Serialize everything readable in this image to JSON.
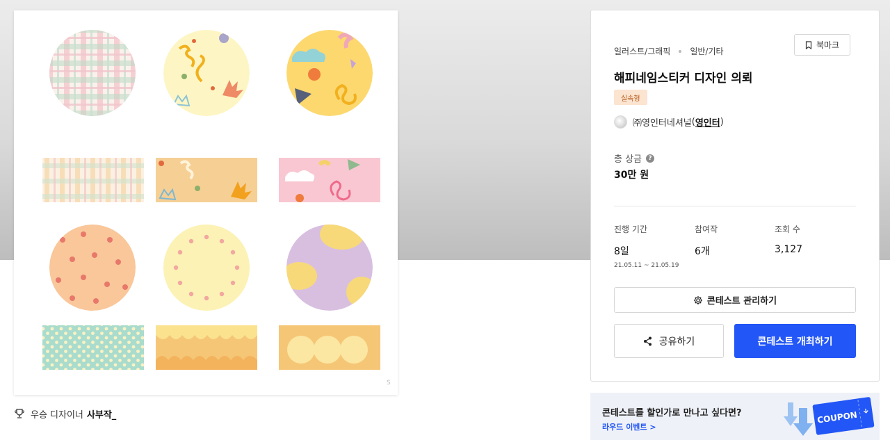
{
  "winner": {
    "label": "우승 디자이너",
    "name": "사부작_"
  },
  "contest": {
    "category": "일러스트/그래픽",
    "subcategory": "일반/기타",
    "title": "해피네임스티커 디자인 의뢰",
    "type_badge": "실속형",
    "host_name": "㈜영인터네셔널",
    "host_handle": "영인터",
    "prize_label": "총 상금",
    "prize_value": "30만 원",
    "stats": {
      "duration_label": "진행 기간",
      "duration_value": "8일",
      "duration_start": "21.05.11",
      "duration_sep": "~",
      "duration_end": "21.05.19",
      "entries_label": "참여작",
      "entries_value": "6개",
      "views_label": "조회 수",
      "views_value": "3,127"
    }
  },
  "buttons": {
    "bookmark": "북마크",
    "manage": "콘테스트 관리하기",
    "share": "공유하기",
    "open_contest": "콘테스트 개최하기"
  },
  "promo": {
    "headline": "콘테스트를 할인가로 만나고 싶다면?",
    "link": "라우드 이벤트 >",
    "coupon_text": "COUPON"
  },
  "icons": {
    "trophy": "trophy-icon",
    "bookmark": "bookmark-icon",
    "help": "help-icon",
    "gear": "gear-icon",
    "share": "share-icon"
  },
  "colors": {
    "primary": "#2356f6",
    "badge_bg": "#fbe4d0",
    "badge_text": "#b85c1e",
    "promo_bg": "#eef1f7"
  }
}
